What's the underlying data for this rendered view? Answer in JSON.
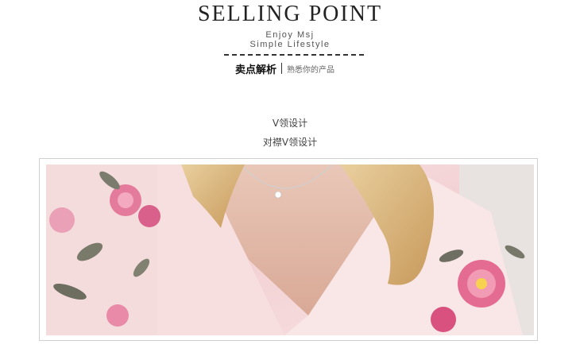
{
  "header": {
    "title": "SELLING POINT",
    "subtitle_line1": "Enjoy Msj",
    "subtitle_line2": "Simple Lifestyle",
    "cn_title": "卖点解析",
    "cn_subtitle": "熟悉你的产品"
  },
  "features": {
    "line1": "V领设计",
    "line2": "对襟V领设计"
  },
  "photo": {
    "icon": "product-photo-pink-floral-robe"
  }
}
